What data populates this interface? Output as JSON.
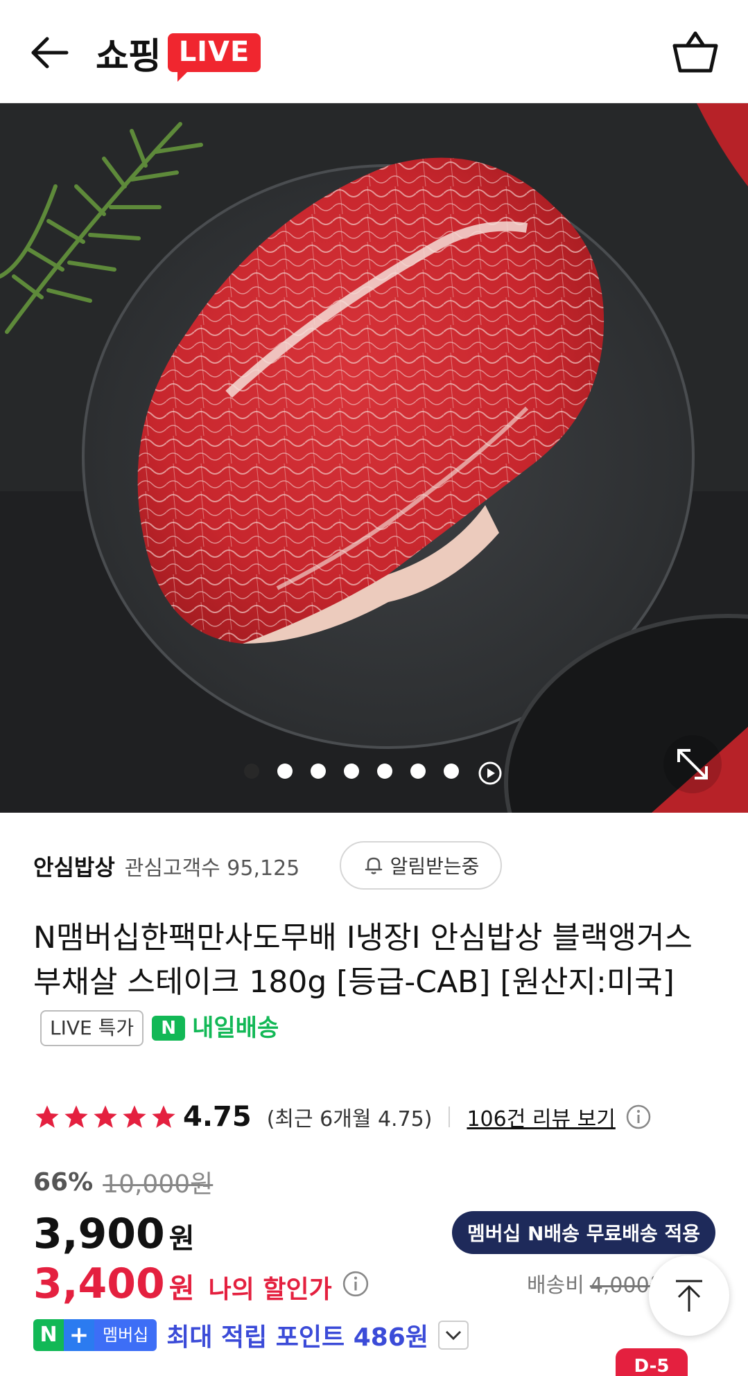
{
  "header": {
    "logo_text": "쇼핑",
    "live_badge": "LIVE",
    "back_icon": "arrow-left-icon",
    "cart_icon": "shopping-basket-icon"
  },
  "hero": {
    "carousel_total_dots": 7,
    "carousel_active_index": 0,
    "play_icon": "play-circle-icon",
    "expand_icon": "expand-diagonal-icon"
  },
  "store": {
    "name": "안심밥상",
    "followers_label": "관심고객수 95,125",
    "alarm_label": "알림받는중"
  },
  "product": {
    "title": "N맴버십한팩만사도무배 I냉장I 안심밥상 블랙앵거스 부채살 스테이크 180g [등급-CAB] [원산지:미국]",
    "live_tag": "LIVE 특가",
    "delivery_n": "N",
    "delivery_label": "내일배송"
  },
  "rating": {
    "stars": 5,
    "score": "4.75",
    "recent": "(최근 6개월 4.75)",
    "review_link": "106건 리뷰 보기"
  },
  "price": {
    "discount": "66%",
    "original": "10,000원",
    "price": "3,900",
    "won": "원",
    "my_price": "3,400",
    "my_won": "원",
    "my_label": "나의 할인가",
    "member_badge": "멤버십 N배송 무료배송 적용",
    "ship_fee_label": "배송비",
    "ship_fee_value": "4,000원"
  },
  "points": {
    "n": "N",
    "plus": "+",
    "membership": "멤버십",
    "text": "최대 적립 포인트 486원"
  },
  "floating": {
    "partial_badge": "D-5"
  },
  "colors": {
    "accent_red": "#e4203f",
    "live_red": "#f0262f",
    "naver_green": "#12b856",
    "navy": "#1e2a5a",
    "points_blue": "#3b4bd8"
  }
}
